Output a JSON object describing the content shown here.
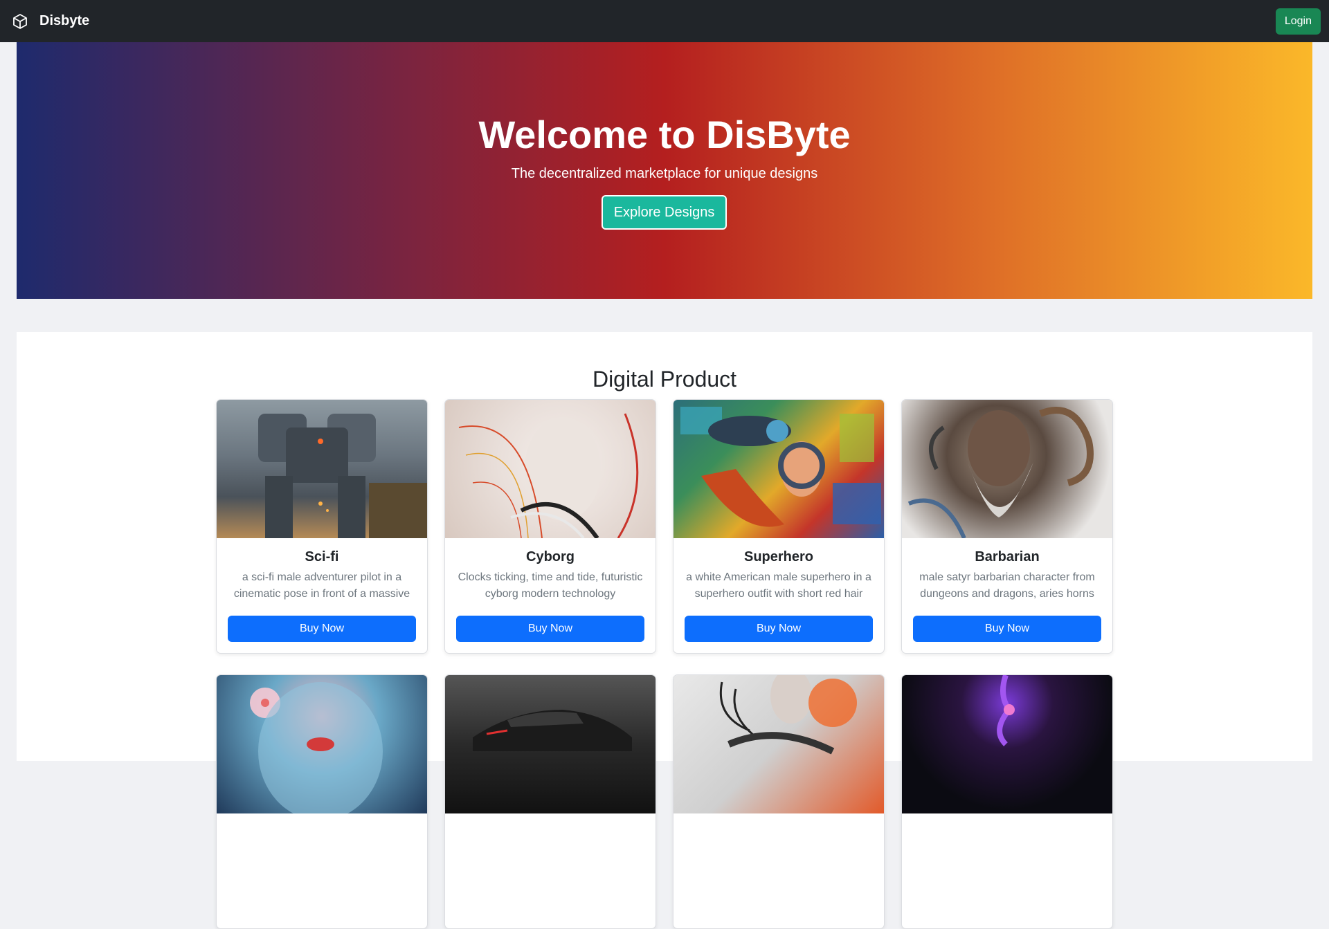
{
  "navbar": {
    "brand_name": "Disbyte",
    "brand_icon": "cube-icon",
    "login_label": "Login",
    "colors": {
      "background": "#212529",
      "login": "#198754"
    }
  },
  "hero": {
    "title": "Welcome to DisByte",
    "subtitle": "The decentralized marketplace for unique designs",
    "cta_label": "Explore Designs",
    "colors": {
      "gradient_start": "#1e2a6d",
      "gradient_mid": "#b41f1f",
      "gradient_end": "#fbb829",
      "cta": "#1ab89d"
    }
  },
  "products": {
    "section_title": "Digital Product",
    "items": [
      {
        "title": "Sci-fi",
        "description": "a sci-fi male adventurer pilot in a cinematic pose in front of a massive",
        "button": "Buy Now"
      },
      {
        "title": "Cyborg",
        "description": "Clocks ticking, time and tide, futuristic cyborg modern technology",
        "button": "Buy Now"
      },
      {
        "title": "Superhero",
        "description": "a white American male superhero in a superhero outfit with short red hair",
        "button": "Buy Now"
      },
      {
        "title": "Barbarian",
        "description": "male satyr barbarian character from dungeons and dragons, aries horns",
        "button": "Buy Now"
      }
    ],
    "button_color": "#0d6efd"
  }
}
